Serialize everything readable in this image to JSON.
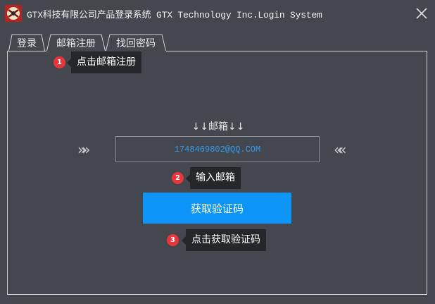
{
  "window": {
    "title": "GTX科技有限公司产品登录系统 GTX Technology Inc.Login System",
    "icon": "app-logo-icon",
    "close_icon": "close-icon"
  },
  "tabs": [
    {
      "label": "登录",
      "active": false
    },
    {
      "label": "邮箱注册",
      "active": true
    },
    {
      "label": "找回密码",
      "active": false
    }
  ],
  "form": {
    "email_label": "↓↓邮箱↓↓",
    "left_chevrons": "»»",
    "right_chevrons": "««",
    "email_value": "1748469802@QQ.COM",
    "button_label": "获取验证码"
  },
  "tooltips": [
    {
      "number": "1",
      "text": "点击邮箱注册"
    },
    {
      "number": "2",
      "text": "输入邮箱"
    },
    {
      "number": "3",
      "text": "点击获取验证码"
    }
  ],
  "colors": {
    "background": "#45474f",
    "accent": "#0d95f8",
    "input_text": "#2e9bf0",
    "badge": "#e8353b",
    "tooltip_bg": "#25272b"
  }
}
